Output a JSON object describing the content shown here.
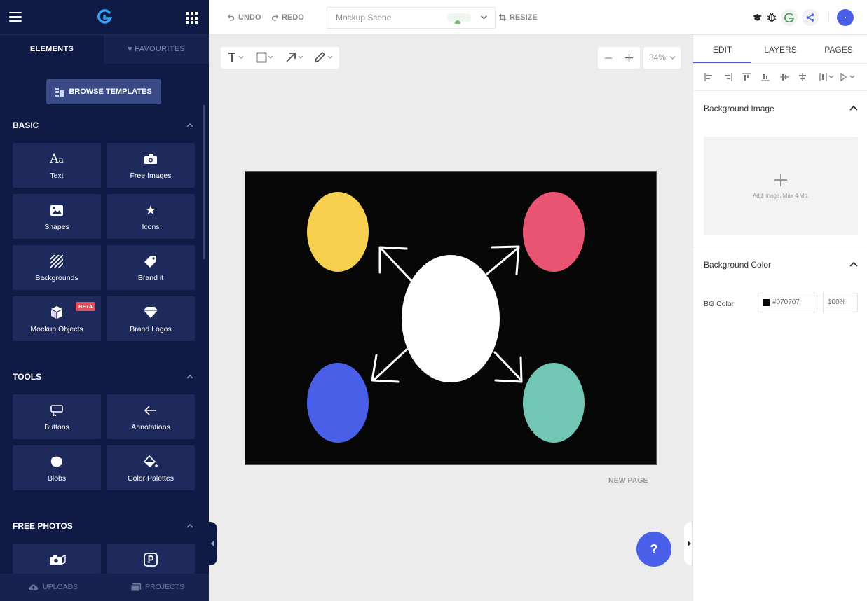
{
  "sidebar": {
    "tabs": {
      "elements": "ELEMENTS",
      "favourites": "FAVOURITES"
    },
    "browse_templates": "BROWSE TEMPLATES",
    "sections": {
      "basic": "BASIC",
      "tools": "TOOLS",
      "free_photos": "FREE PHOTOS"
    },
    "basic_items": [
      "Text",
      "Free Images",
      "Shapes",
      "Icons",
      "Backgrounds",
      "Brand it",
      "Mockup Objects",
      "Brand Logos"
    ],
    "beta_badge": "BETA",
    "tools_items": [
      "Buttons",
      "Annotations",
      "Blobs",
      "Color Palettes"
    ],
    "bottom": {
      "uploads": "UPLOADS",
      "projects": "PROJECTS"
    }
  },
  "topbar": {
    "undo": "UNDO",
    "redo": "REDO",
    "scene_name": "Mockup Scene",
    "resize": "RESIZE"
  },
  "canvas": {
    "zoom": "34%",
    "new_page": "NEW PAGE",
    "help": "?",
    "background_color": "#070707",
    "shapes": {
      "center": "#ffffff",
      "top_left": "#f8d04f",
      "top_right": "#e85471",
      "bottom_left": "#4a5fe8",
      "bottom_right": "#72c8b4"
    }
  },
  "right_panel": {
    "tabs": {
      "edit": "EDIT",
      "layers": "LAYERS",
      "pages": "PAGES"
    },
    "background_image": {
      "title": "Background Image",
      "hint": "Add image. Max 4 Mb."
    },
    "background_color": {
      "title": "Background Color",
      "label": "BG Color",
      "value": "#070707",
      "opacity": "100%"
    }
  },
  "colors": {
    "sidebar_bg": "#0f1a45",
    "tile_bg": "#1e2a5c",
    "accent": "#4a5fe8"
  }
}
